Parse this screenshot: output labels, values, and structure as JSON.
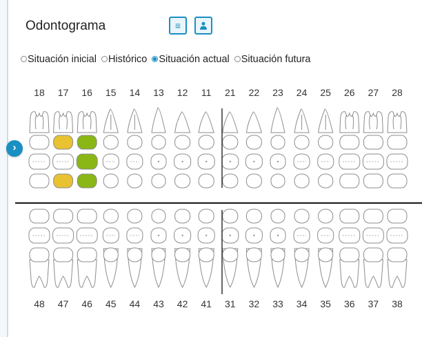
{
  "title": "Odontograma",
  "view_buttons": [
    {
      "name": "list-view-button",
      "icon": "list-icon"
    },
    {
      "name": "patient-view-button",
      "icon": "person-icon"
    }
  ],
  "situations": [
    {
      "label": "Situación inicial",
      "selected": false
    },
    {
      "label": "Histórico",
      "selected": false
    },
    {
      "label": "Situación actual",
      "selected": true
    },
    {
      "label": "Situación futura",
      "selected": false
    }
  ],
  "expand_icon": "›",
  "upper_teeth": [
    "18",
    "17",
    "16",
    "15",
    "14",
    "13",
    "12",
    "11",
    "21",
    "22",
    "23",
    "24",
    "25",
    "26",
    "27",
    "28"
  ],
  "lower_teeth": [
    "48",
    "47",
    "46",
    "45",
    "44",
    "43",
    "42",
    "41",
    "31",
    "32",
    "33",
    "34",
    "35",
    "36",
    "37",
    "38"
  ],
  "markings": [
    {
      "tooth": "17",
      "color": "#e8c230",
      "surfaces": [
        "vestibular",
        "lingual"
      ]
    },
    {
      "tooth": "16",
      "color": "#8ab715",
      "surfaces": [
        "vestibular",
        "occlusal",
        "lingual"
      ]
    }
  ],
  "colors": {
    "accent": "#1a8fc2",
    "outline": "#8c8c8c"
  }
}
